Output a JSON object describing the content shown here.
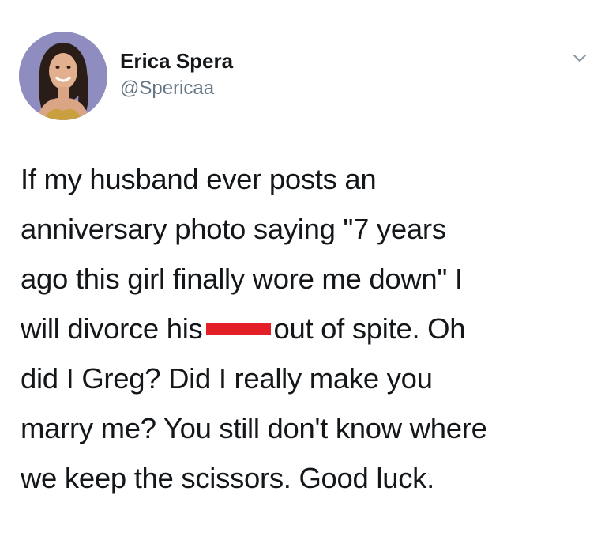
{
  "author": {
    "display_name": "Erica Spera",
    "handle": "@Spericaa"
  },
  "tweet": {
    "lines": [
      "If my husband ever posts an",
      "anniversary photo saying \"7 years",
      "ago this girl finally wore me down\" I"
    ],
    "line4_before": "will divorce his",
    "line4_after": "out of spite. Oh",
    "lines_rest": [
      "did I Greg? Did I really make you",
      "marry me? You still don't know where",
      "we keep the scissors. Good luck."
    ],
    "redaction_color": "#e32027"
  },
  "icons": {
    "avatar": "profile-photo",
    "menu": "chevron-down-icon"
  }
}
